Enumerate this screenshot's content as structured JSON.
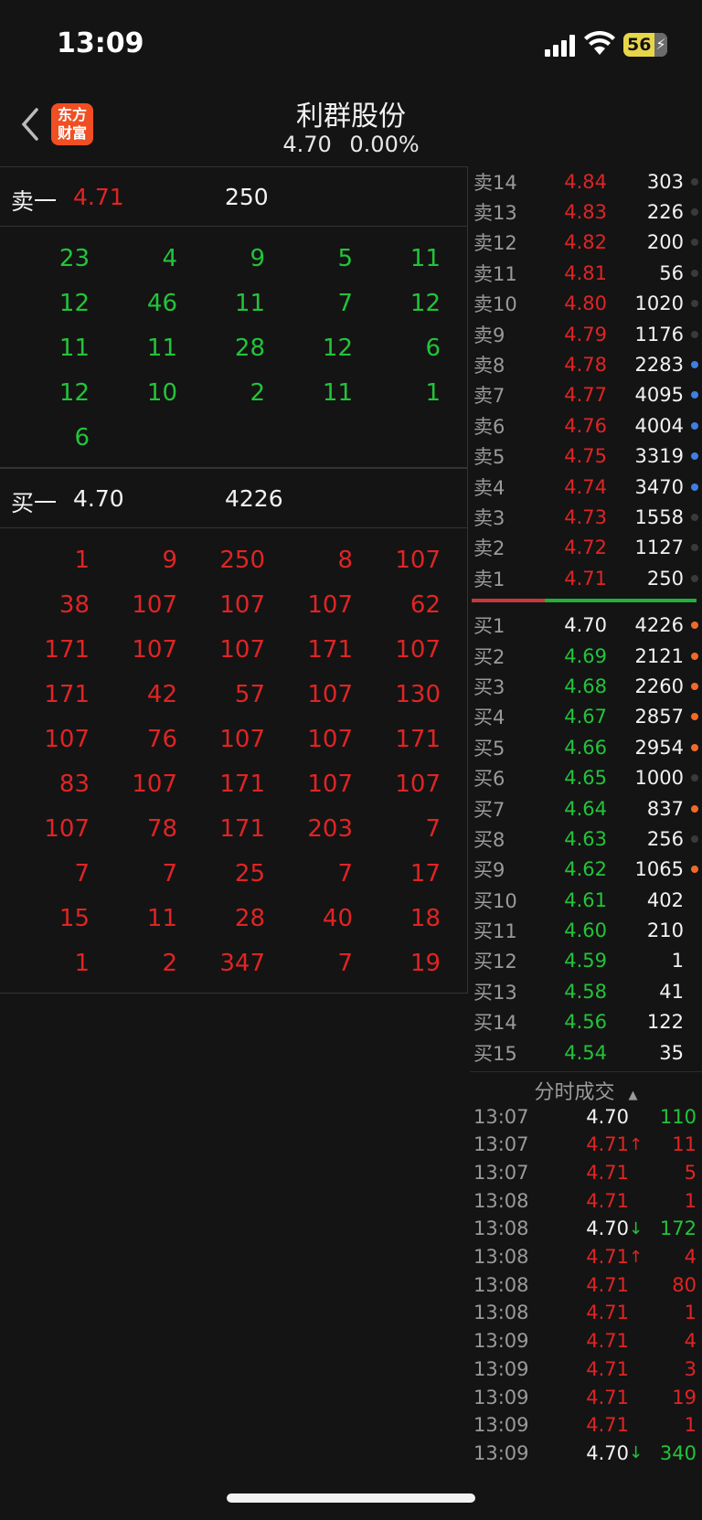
{
  "status_bar": {
    "time": "13:09",
    "battery": "56",
    "icons": [
      "signal-icon",
      "wifi-icon",
      "battery-charging-icon"
    ]
  },
  "nav": {
    "back_icon": "chevron-left-icon",
    "logo_text_top": "东方",
    "logo_text_bottom": "财富",
    "title": "利群股份",
    "price": "4.70",
    "change": "0.00%"
  },
  "sell_one": {
    "label": "卖一",
    "price": "4.71",
    "volume": "250"
  },
  "sell_queue": [
    [
      "23",
      "4",
      "9",
      "5",
      "11"
    ],
    [
      "12",
      "46",
      "11",
      "7",
      "12"
    ],
    [
      "11",
      "11",
      "28",
      "12",
      "6"
    ],
    [
      "12",
      "10",
      "2",
      "11",
      "1"
    ],
    [
      "6"
    ]
  ],
  "buy_one": {
    "label": "买一",
    "price": "4.70",
    "volume": "4226"
  },
  "buy_queue": [
    [
      "1",
      "9",
      "250",
      "8",
      "107"
    ],
    [
      "38",
      "107",
      "107",
      "107",
      "62"
    ],
    [
      "171",
      "107",
      "107",
      "171",
      "107"
    ],
    [
      "171",
      "42",
      "57",
      "107",
      "130"
    ],
    [
      "107",
      "76",
      "107",
      "107",
      "171"
    ],
    [
      "83",
      "107",
      "171",
      "107",
      "107"
    ],
    [
      "107",
      "78",
      "171",
      "203",
      "7"
    ],
    [
      "7",
      "7",
      "25",
      "7",
      "17"
    ],
    [
      "15",
      "11",
      "28",
      "40",
      "18"
    ],
    [
      "1",
      "2",
      "347",
      "7",
      "19"
    ]
  ],
  "asks": [
    {
      "level": "卖14",
      "price": "4.84",
      "vol": "303",
      "dot": "dim"
    },
    {
      "level": "卖13",
      "price": "4.83",
      "vol": "226",
      "dot": "dim"
    },
    {
      "level": "卖12",
      "price": "4.82",
      "vol": "200",
      "dot": "dim"
    },
    {
      "level": "卖11",
      "price": "4.81",
      "vol": "56",
      "dot": "dim"
    },
    {
      "level": "卖10",
      "price": "4.80",
      "vol": "1020",
      "dot": "dim"
    },
    {
      "level": "卖9",
      "price": "4.79",
      "vol": "1176",
      "dot": "dim"
    },
    {
      "level": "卖8",
      "price": "4.78",
      "vol": "2283",
      "dot": "blue"
    },
    {
      "level": "卖7",
      "price": "4.77",
      "vol": "4095",
      "dot": "blue"
    },
    {
      "level": "卖6",
      "price": "4.76",
      "vol": "4004",
      "dot": "blue"
    },
    {
      "level": "卖5",
      "price": "4.75",
      "vol": "3319",
      "dot": "blue"
    },
    {
      "level": "卖4",
      "price": "4.74",
      "vol": "3470",
      "dot": "blue"
    },
    {
      "level": "卖3",
      "price": "4.73",
      "vol": "1558",
      "dot": "dim"
    },
    {
      "level": "卖2",
      "price": "4.72",
      "vol": "1127",
      "dot": "dim"
    },
    {
      "level": "卖1",
      "price": "4.71",
      "vol": "250",
      "dot": "dim"
    }
  ],
  "bids": [
    {
      "level": "买1",
      "price": "4.70",
      "vol": "4226",
      "dot": "orange",
      "pc": "white"
    },
    {
      "level": "买2",
      "price": "4.69",
      "vol": "2121",
      "dot": "orange",
      "pc": "green"
    },
    {
      "level": "买3",
      "price": "4.68",
      "vol": "2260",
      "dot": "orange",
      "pc": "green"
    },
    {
      "level": "买4",
      "price": "4.67",
      "vol": "2857",
      "dot": "orange",
      "pc": "green"
    },
    {
      "level": "买5",
      "price": "4.66",
      "vol": "2954",
      "dot": "orange",
      "pc": "green"
    },
    {
      "level": "买6",
      "price": "4.65",
      "vol": "1000",
      "dot": "dim",
      "pc": "green"
    },
    {
      "level": "买7",
      "price": "4.64",
      "vol": "837",
      "dot": "orange",
      "pc": "green"
    },
    {
      "level": "买8",
      "price": "4.63",
      "vol": "256",
      "dot": "dim",
      "pc": "green"
    },
    {
      "level": "买9",
      "price": "4.62",
      "vol": "1065",
      "dot": "orange",
      "pc": "green"
    },
    {
      "level": "买10",
      "price": "4.61",
      "vol": "402",
      "dot": "none",
      "pc": "green"
    },
    {
      "level": "买11",
      "price": "4.60",
      "vol": "210",
      "dot": "none",
      "pc": "green"
    },
    {
      "level": "买12",
      "price": "4.59",
      "vol": "1",
      "dot": "none",
      "pc": "green"
    },
    {
      "level": "买13",
      "price": "4.58",
      "vol": "41",
      "dot": "none",
      "pc": "green"
    },
    {
      "level": "买14",
      "price": "4.56",
      "vol": "122",
      "dot": "none",
      "pc": "green"
    },
    {
      "level": "买15",
      "price": "4.54",
      "vol": "35",
      "dot": "none",
      "pc": "green"
    }
  ],
  "trades_title": "分时成交",
  "trades": [
    {
      "time": "13:07",
      "price": "4.70",
      "arrow": "",
      "pc": "white",
      "vol": "110",
      "vc": "green"
    },
    {
      "time": "13:07",
      "price": "4.71",
      "arrow": "↑",
      "pc": "red",
      "vol": "11",
      "vc": "red"
    },
    {
      "time": "13:07",
      "price": "4.71",
      "arrow": "",
      "pc": "red",
      "vol": "5",
      "vc": "red"
    },
    {
      "time": "13:08",
      "price": "4.71",
      "arrow": "",
      "pc": "red",
      "vol": "1",
      "vc": "red"
    },
    {
      "time": "13:08",
      "price": "4.70",
      "arrow": "↓",
      "pc": "white",
      "vol": "172",
      "vc": "green"
    },
    {
      "time": "13:08",
      "price": "4.71",
      "arrow": "↑",
      "pc": "red",
      "vol": "4",
      "vc": "red"
    },
    {
      "time": "13:08",
      "price": "4.71",
      "arrow": "",
      "pc": "red",
      "vol": "80",
      "vc": "red"
    },
    {
      "time": "13:08",
      "price": "4.71",
      "arrow": "",
      "pc": "red",
      "vol": "1",
      "vc": "red"
    },
    {
      "time": "13:09",
      "price": "4.71",
      "arrow": "",
      "pc": "red",
      "vol": "4",
      "vc": "red"
    },
    {
      "time": "13:09",
      "price": "4.71",
      "arrow": "",
      "pc": "red",
      "vol": "3",
      "vc": "red"
    },
    {
      "time": "13:09",
      "price": "4.71",
      "arrow": "",
      "pc": "red",
      "vol": "19",
      "vc": "red"
    },
    {
      "time": "13:09",
      "price": "4.71",
      "arrow": "",
      "pc": "red",
      "vol": "1",
      "vc": "red"
    },
    {
      "time": "13:09",
      "price": "4.70",
      "arrow": "↓",
      "pc": "white",
      "vol": "340",
      "vc": "green"
    }
  ]
}
